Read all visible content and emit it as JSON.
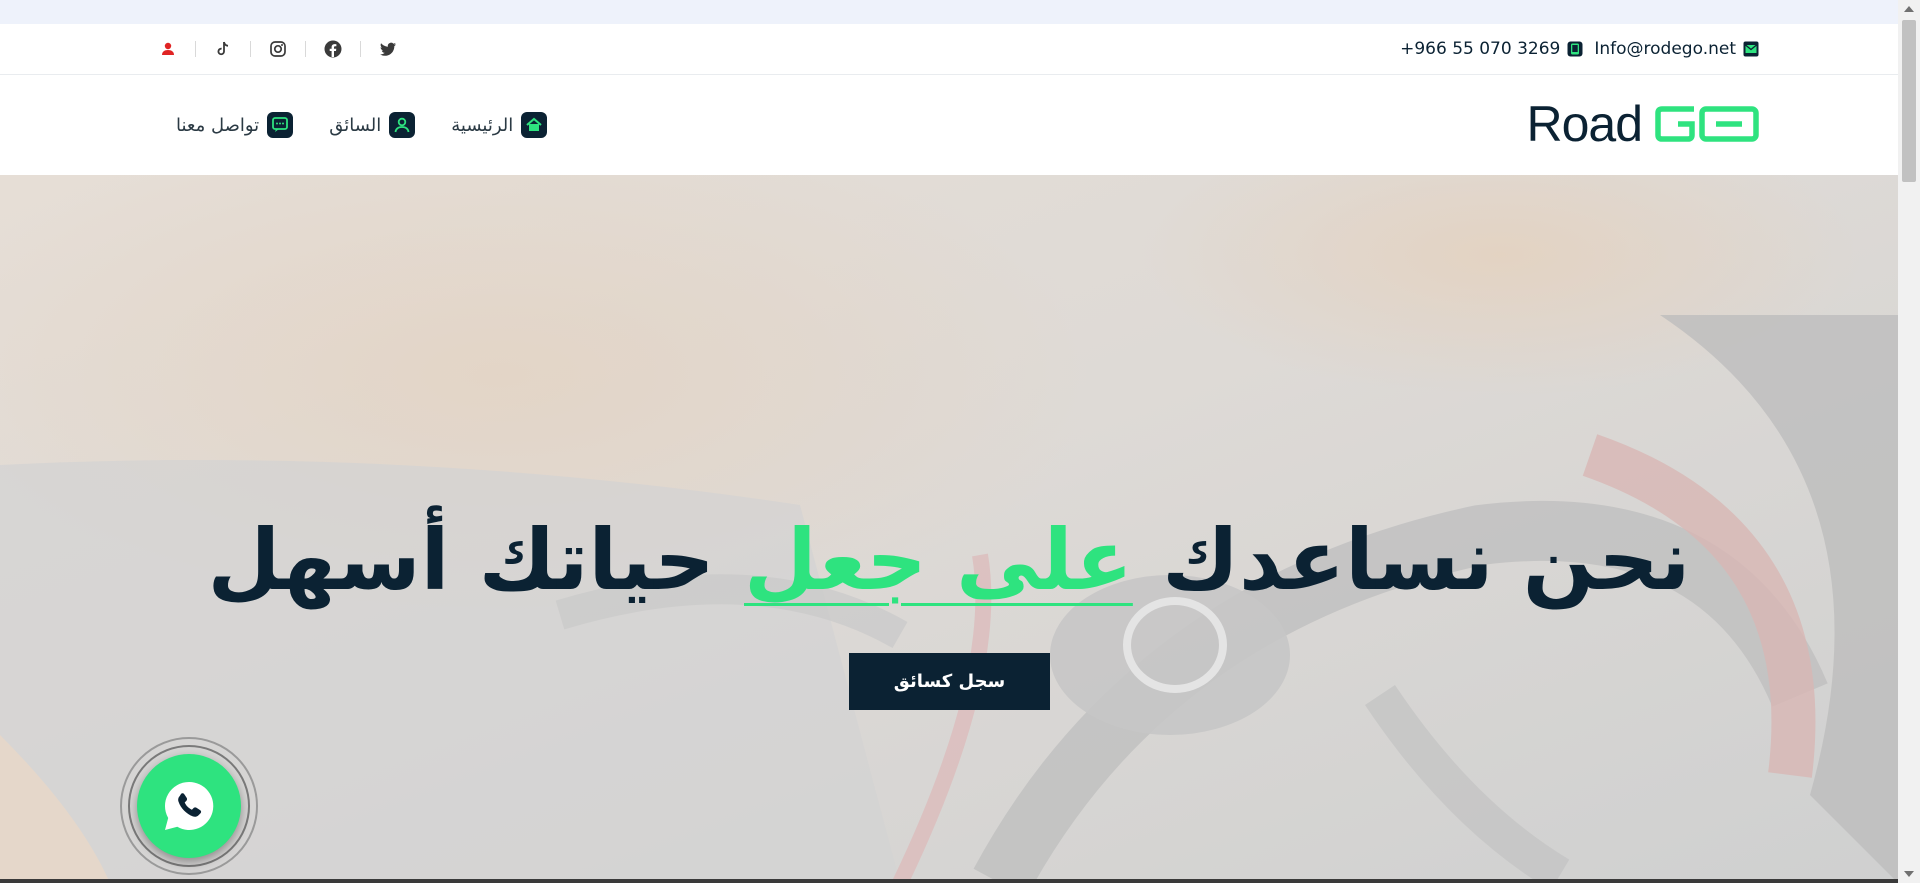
{
  "contact": {
    "phone": "+966 55 070 3269",
    "email": "Info@rodego.net"
  },
  "socials": [
    "user-icon",
    "tiktok-icon",
    "instagram-icon",
    "facebook-icon",
    "twitter-icon"
  ],
  "logo": {
    "text": "Road"
  },
  "nav": {
    "home": "الرئيسية",
    "driver": "السائق",
    "contact": "تواصل معنا"
  },
  "hero": {
    "title_part1": "نحن نساعدك ",
    "title_accent": "على جعل",
    "title_part2": " حياتك أسهل",
    "cta": "سجل كسائق"
  },
  "colors": {
    "accent": "#2ee37f",
    "dark": "#0b2233"
  }
}
